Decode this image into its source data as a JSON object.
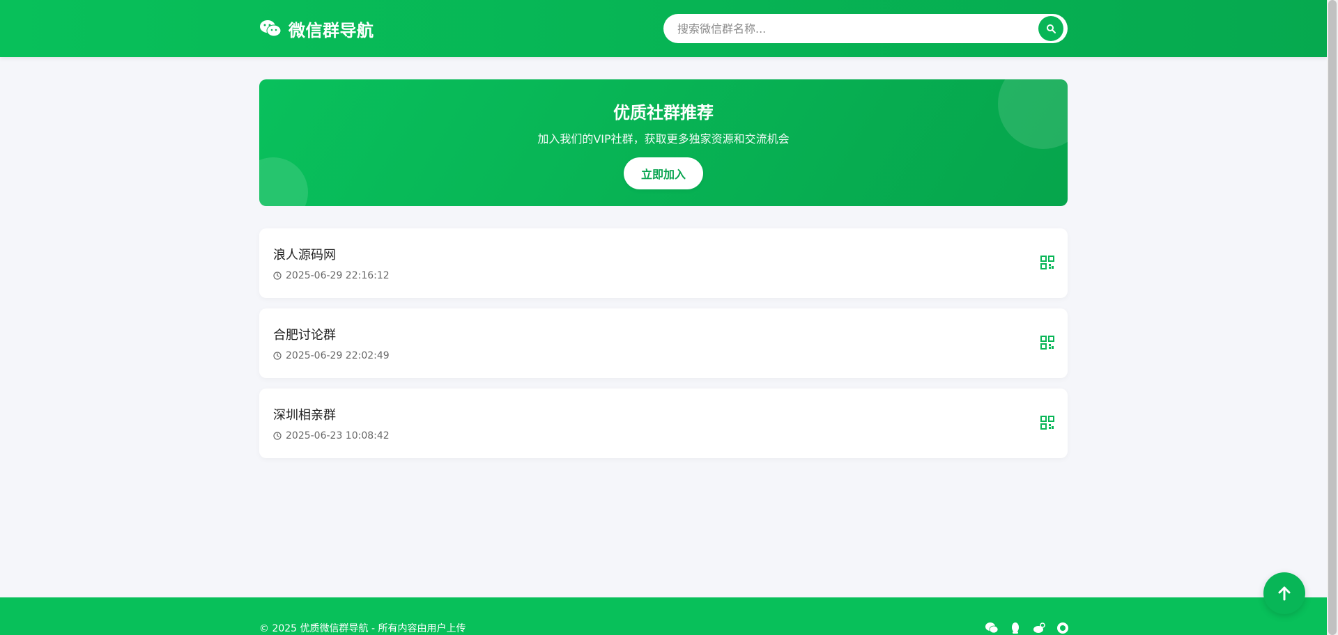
{
  "header": {
    "brand": "微信群导航",
    "search_placeholder": "搜索微信群名称..."
  },
  "banner": {
    "title": "优质社群推荐",
    "subtitle": "加入我们的VIP社群，获取更多独家资源和交流机会",
    "button": "立即加入"
  },
  "groups": [
    {
      "name": "浪人源码网",
      "time": "2025-06-29 22:16:12"
    },
    {
      "name": "合肥讨论群",
      "time": "2025-06-29 22:02:49"
    },
    {
      "name": "深圳相亲群",
      "time": "2025-06-23 10:08:42"
    }
  ],
  "footer": {
    "copyright": "© 2025 优质微信群导航 - 所有内容由用户上传",
    "icons": [
      "wechat-icon",
      "qq-icon",
      "weibo-icon",
      "github-icon"
    ]
  },
  "colors": {
    "primary": "#08c05a",
    "primary_dark": "#06a54c",
    "background": "#f5f6fa"
  }
}
